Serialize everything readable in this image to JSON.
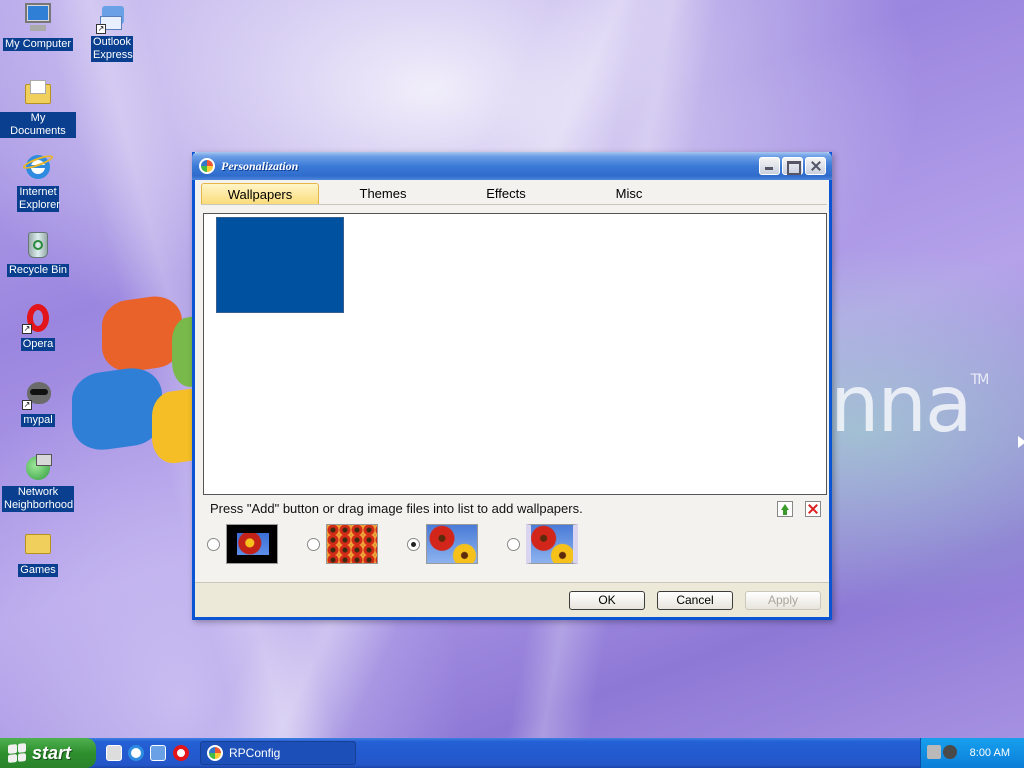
{
  "desktop": {
    "icons": [
      {
        "label": "My Computer",
        "icon": "computer-icon"
      },
      {
        "label": "Outlook Express",
        "icon": "outlook-express-icon"
      },
      {
        "label": "My Documents",
        "icon": "folder-icon"
      },
      {
        "label": "Internet Explorer",
        "icon": "internet-explorer-icon"
      },
      {
        "label": "Recycle Bin",
        "icon": "recycle-bin-icon"
      },
      {
        "label": "Opera",
        "icon": "opera-icon"
      },
      {
        "label": "mypal",
        "icon": "mypal-icon"
      },
      {
        "label": "Network Neighborhood",
        "icon": "network-icon"
      },
      {
        "label": "Games",
        "icon": "folder-icon"
      }
    ],
    "wallpaper_brand": "nna",
    "wallpaper_tm": "TM"
  },
  "window": {
    "title": "Personalization",
    "tabs": [
      "Wallpapers",
      "Themes",
      "Effects",
      "Misc"
    ],
    "active_tab": "Wallpapers",
    "wallpaper_items": [
      {
        "color": "#0052a0"
      }
    ],
    "hint": "Press \"Add\" button or drag image files into list to add wallpapers.",
    "styles": [
      {
        "name": "center",
        "selected": false
      },
      {
        "name": "tile",
        "selected": false
      },
      {
        "name": "stretch",
        "selected": true
      },
      {
        "name": "fill",
        "selected": false
      }
    ],
    "buttons": {
      "ok": "OK",
      "cancel": "Cancel",
      "apply": "Apply"
    }
  },
  "taskbar": {
    "start_label": "start",
    "quick_launch": [
      "show-desktop-icon",
      "internet-explorer-icon",
      "outlook-express-icon",
      "opera-icon"
    ],
    "task_label": "RPConfig",
    "clock": "8:00 AM"
  },
  "colors": {
    "accent": "#0a55d4",
    "selected_tab": "#fbdc7a",
    "taskbar": "#235ad0",
    "start": "#2e8f2e"
  }
}
